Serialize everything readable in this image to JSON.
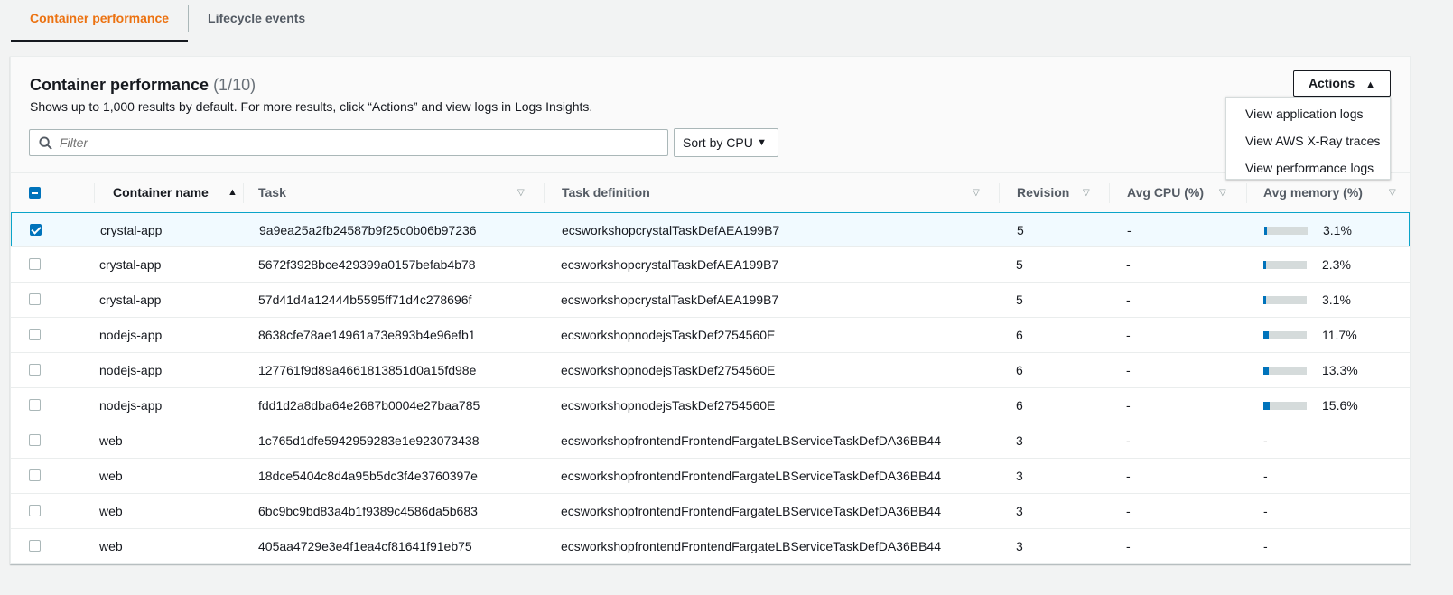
{
  "tabs": [
    {
      "label": "Container performance",
      "active": true
    },
    {
      "label": "Lifecycle events",
      "active": false
    }
  ],
  "panel": {
    "title": "Container performance",
    "count": "(1/10)",
    "description": "Shows up to 1,000 results by default. For more results, click “Actions” and view logs in Logs Insights.",
    "filter_placeholder": "Filter",
    "sort_label": "Sort by CPU",
    "actions_label": "Actions",
    "actions_menu": [
      "View application logs",
      "View AWS X-Ray traces",
      "View performance logs"
    ]
  },
  "columns": [
    "Container name",
    "Task",
    "Task definition",
    "Revision",
    "Avg CPU (%)",
    "Avg memory (%)"
  ],
  "colors": {
    "accent": "#ec7211",
    "primary": "#0073bb"
  },
  "rows": [
    {
      "selected": true,
      "name": "crystal-app",
      "task": "9a9ea25a2fb24587b9f25c0b06b97236",
      "def": "ecsworkshopcrystalTaskDefAEA199B7",
      "rev": "5",
      "cpu": "-",
      "mem": "3.1%",
      "mem_value": 3.1
    },
    {
      "selected": false,
      "name": "crystal-app",
      "task": "5672f3928bce429399a0157befab4b78",
      "def": "ecsworkshopcrystalTaskDefAEA199B7",
      "rev": "5",
      "cpu": "-",
      "mem": "2.3%",
      "mem_value": 2.3
    },
    {
      "selected": false,
      "name": "crystal-app",
      "task": "57d41d4a12444b5595ff71d4c278696f",
      "def": "ecsworkshopcrystalTaskDefAEA199B7",
      "rev": "5",
      "cpu": "-",
      "mem": "3.1%",
      "mem_value": 3.1
    },
    {
      "selected": false,
      "name": "nodejs-app",
      "task": "8638cfe78ae14961a73e893b4e96efb1",
      "def": "ecsworkshopnodejsTaskDef2754560E",
      "rev": "6",
      "cpu": "-",
      "mem": "11.7%",
      "mem_value": 11.7
    },
    {
      "selected": false,
      "name": "nodejs-app",
      "task": "127761f9d89a4661813851d0a15fd98e",
      "def": "ecsworkshopnodejsTaskDef2754560E",
      "rev": "6",
      "cpu": "-",
      "mem": "13.3%",
      "mem_value": 13.3
    },
    {
      "selected": false,
      "name": "nodejs-app",
      "task": "fdd1d2a8dba64e2687b0004e27baa785",
      "def": "ecsworkshopnodejsTaskDef2754560E",
      "rev": "6",
      "cpu": "-",
      "mem": "15.6%",
      "mem_value": 15.6
    },
    {
      "selected": false,
      "name": "web",
      "task": "1c765d1dfe5942959283e1e923073438",
      "def": "ecsworkshopfrontendFrontendFargateLBServiceTaskDefDA36BB44",
      "rev": "3",
      "cpu": "-",
      "mem": "-",
      "mem_value": null
    },
    {
      "selected": false,
      "name": "web",
      "task": "18dce5404c8d4a95b5dc3f4e3760397e",
      "def": "ecsworkshopfrontendFrontendFargateLBServiceTaskDefDA36BB44",
      "rev": "3",
      "cpu": "-",
      "mem": "-",
      "mem_value": null
    },
    {
      "selected": false,
      "name": "web",
      "task": "6bc9bc9bd83a4b1f9389c4586da5b683",
      "def": "ecsworkshopfrontendFrontendFargateLBServiceTaskDefDA36BB44",
      "rev": "3",
      "cpu": "-",
      "mem": "-",
      "mem_value": null
    },
    {
      "selected": false,
      "name": "web",
      "task": "405aa4729e3e4f1ea4cf81641f91eb75",
      "def": "ecsworkshopfrontendFrontendFargateLBServiceTaskDefDA36BB44",
      "rev": "3",
      "cpu": "-",
      "mem": "-",
      "mem_value": null
    }
  ]
}
